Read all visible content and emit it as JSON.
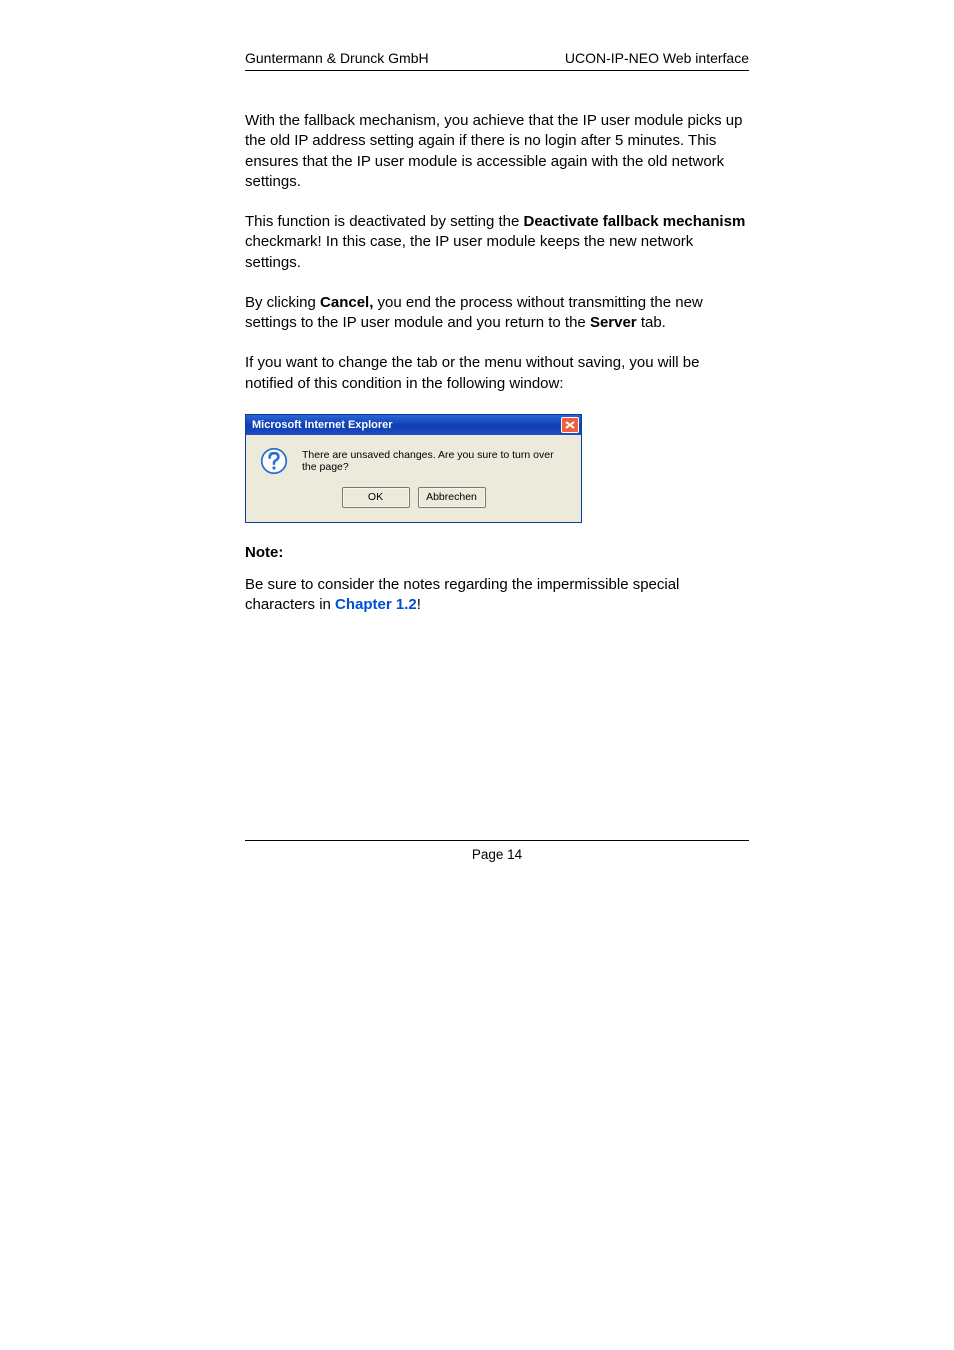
{
  "header": {
    "left": "Guntermann & Drunck GmbH",
    "right": "UCON-IP-NEO Web interface"
  },
  "paragraphs": {
    "p1": "With the fallback mechanism, you achieve that the IP user module picks up the old IP address setting again if there is no login after 5 minutes. This ensures that the IP user module is accessible again with the old network settings.",
    "p2a": "This function is deactivated by setting the ",
    "p2b": "Deactivate fallback mechanism",
    "p2c": " checkmark! In this case, the IP user module keeps the new network settings.",
    "p3a": "By clicking ",
    "p3b": "Cancel,",
    "p3c": " you end the process without transmitting the new settings to the IP user module and you return to the ",
    "p3d": "Server",
    "p3e": " tab.",
    "p4": "If you want to change the tab or the menu without saving, you will be notified of this condition in the following window:",
    "note_label": "Note:",
    "note_text_a": "Be sure to consider the notes regarding the impermissible special characters in ",
    "note_link": "Chapter 1.2",
    "note_text_b": "!"
  },
  "dialog": {
    "title": "Microsoft Internet Explorer",
    "message": "There are unsaved changes. Are you sure to turn over the page?",
    "ok": "OK",
    "cancel": "Abbrechen"
  },
  "footer": {
    "page": "Page 14"
  }
}
